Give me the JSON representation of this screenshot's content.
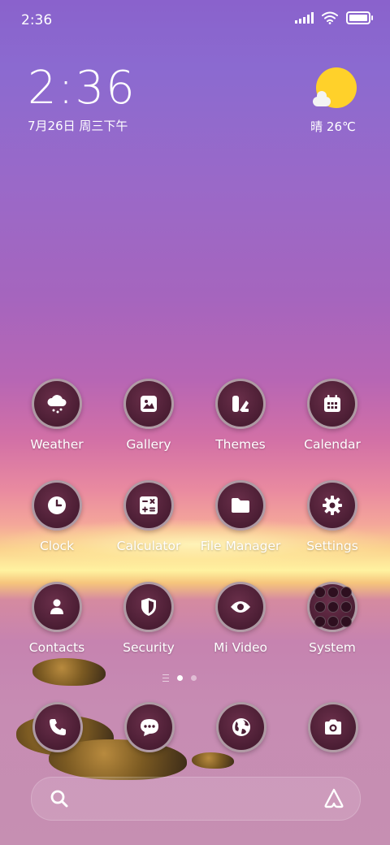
{
  "status_bar": {
    "time": "2:36",
    "icons": [
      "signal-icon",
      "wifi-icon",
      "battery-icon"
    ]
  },
  "clock_widget": {
    "time": "2:36",
    "date": "7月26日 周三下午"
  },
  "weather_widget": {
    "condition_temp": "晴 26℃",
    "icon": "sunny-cloud-icon"
  },
  "apps": [
    {
      "label": "Weather",
      "icon": "weather-icon"
    },
    {
      "label": "Gallery",
      "icon": "gallery-icon"
    },
    {
      "label": "Themes",
      "icon": "themes-icon"
    },
    {
      "label": "Calendar",
      "icon": "calendar-icon"
    },
    {
      "label": "Clock",
      "icon": "clock-icon"
    },
    {
      "label": "Calculator",
      "icon": "calculator-icon"
    },
    {
      "label": "File Manager",
      "icon": "folder-icon"
    },
    {
      "label": "Settings",
      "icon": "gear-icon"
    },
    {
      "label": "Contacts",
      "icon": "contacts-icon"
    },
    {
      "label": "Security",
      "icon": "shield-icon"
    },
    {
      "label": "Mi Video",
      "icon": "eye-icon"
    },
    {
      "label": "System",
      "icon": "folder-grid-icon"
    }
  ],
  "page_indicator": {
    "pages": 2,
    "active": 0
  },
  "dock": [
    {
      "icon": "phone-icon"
    },
    {
      "icon": "message-icon"
    },
    {
      "icon": "browser-icon"
    },
    {
      "icon": "camera-icon"
    }
  ],
  "search_bar": {
    "left_icon": "search-icon",
    "right_icon": "assistant-icon"
  },
  "colors": {
    "icon_bg": "#4a1d33",
    "sun": "#ffd12a",
    "sky_top": "#8a62cc",
    "horizon": "#fff2a0"
  }
}
